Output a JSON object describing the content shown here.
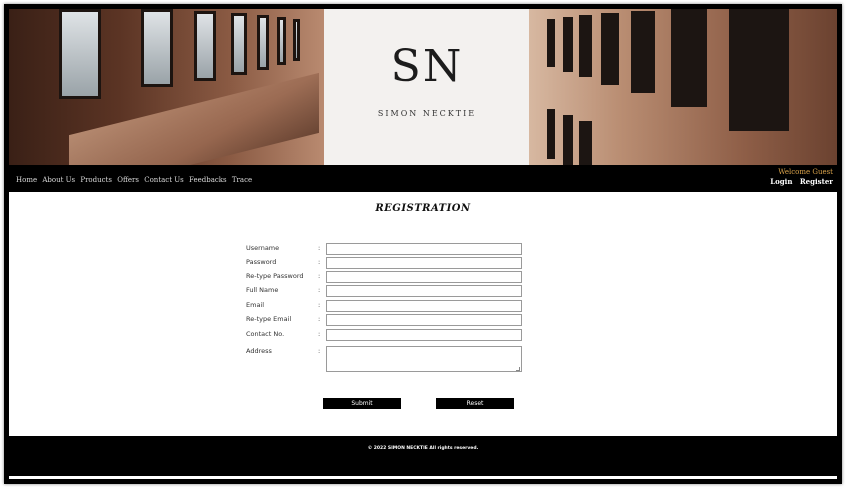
{
  "brand": {
    "logo": "SN",
    "tagline": "SIMON NECKTIE"
  },
  "nav": {
    "items": [
      "Home",
      "About Us",
      "Products",
      "Offers",
      "Contact Us",
      "Feedbacks",
      "Trace"
    ],
    "welcome": "Welcome Guest",
    "login": "Login",
    "register": "Register"
  },
  "page_title": "REGISTRATION",
  "form": {
    "fields": [
      {
        "label": "Username",
        "value": ""
      },
      {
        "label": "Password",
        "value": ""
      },
      {
        "label": "Re-type Password",
        "value": ""
      },
      {
        "label": "Full Name",
        "value": ""
      },
      {
        "label": "Email",
        "value": ""
      },
      {
        "label": "Re-type Email",
        "value": ""
      },
      {
        "label": "Contact No.",
        "value": ""
      },
      {
        "label": "Address",
        "value": ""
      }
    ],
    "colon": ":",
    "submit_label": "Submit",
    "reset_label": "Reset"
  },
  "footer": {
    "copyright": "© 2022 SIMON NECKTIE All rights reserved."
  },
  "colors": {
    "nav_bg": "#000000",
    "welcome": "#d9a24a",
    "button_bg": "#000000"
  },
  "icons": {
    "textarea_resize": "resize-grip-icon"
  }
}
